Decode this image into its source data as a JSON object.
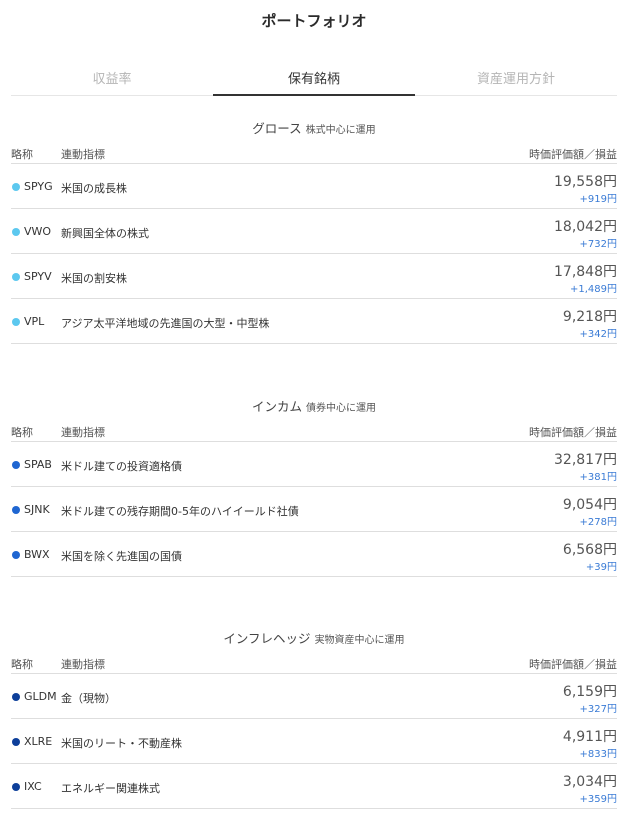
{
  "title": "ポートフォリオ",
  "tabs": [
    {
      "label": "収益率"
    },
    {
      "label": "保有銘柄"
    },
    {
      "label": "資産運用方針"
    }
  ],
  "header": {
    "col_abbr": "略称",
    "col_index": "連動指標",
    "col_value": "時価評価額／損益"
  },
  "colors": {
    "growth_dot": "#5cc8ef",
    "income_dot": "#1f66d1",
    "inflation_dot": "#0d3f9a",
    "gain_text": "#3a7bd5"
  },
  "sections": [
    {
      "name": "グロース",
      "sub": "株式中心に運用",
      "rows": [
        {
          "ticker": "SPYG",
          "index": "米国の成長株",
          "value": "19,558円",
          "gain": "+919円"
        },
        {
          "ticker": "VWO",
          "index": "新興国全体の株式",
          "value": "18,042円",
          "gain": "+732円"
        },
        {
          "ticker": "SPYV",
          "index": "米国の割安株",
          "value": "17,848円",
          "gain": "+1,489円"
        },
        {
          "ticker": "VPL",
          "index": "アジア太平洋地域の先進国の大型・中型株",
          "value": "9,218円",
          "gain": "+342円"
        }
      ]
    },
    {
      "name": "インカム",
      "sub": "債券中心に運用",
      "rows": [
        {
          "ticker": "SPAB",
          "index": "米ドル建ての投資適格債",
          "value": "32,817円",
          "gain": "+381円"
        },
        {
          "ticker": "SJNK",
          "index": "米ドル建ての残存期間0-5年のハイイールド社債",
          "value": "9,054円",
          "gain": "+278円"
        },
        {
          "ticker": "BWX",
          "index": "米国を除く先進国の国債",
          "value": "6,568円",
          "gain": "+39円"
        }
      ]
    },
    {
      "name": "インフレヘッジ",
      "sub": "実物資産中心に運用",
      "rows": [
        {
          "ticker": "GLDM",
          "index": "金（現物）",
          "value": "6,159円",
          "gain": "+327円"
        },
        {
          "ticker": "XLRE",
          "index": "米国のリート・不動産株",
          "value": "4,911円",
          "gain": "+833円"
        },
        {
          "ticker": "IXC",
          "index": "エネルギー関連株式",
          "value": "3,034円",
          "gain": "+359円"
        }
      ]
    }
  ]
}
